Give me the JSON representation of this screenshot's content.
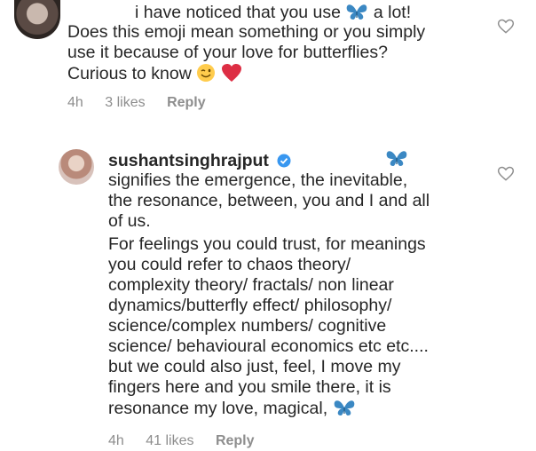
{
  "comment1": {
    "lines": [
      "i have noticed that you use",
      "a lot!",
      "Does this emoji mean something or you simply",
      "use it because of your love for butterflies?",
      "Curious to know"
    ],
    "meta": {
      "time": "4h",
      "likes": "3 likes",
      "reply": "Reply"
    }
  },
  "comment2": {
    "username": "sushantsinghrajput",
    "lines": [
      "signifies the emergence, the inevitable,",
      "the resonance, between, you and I and all",
      "of us.",
      "For feelings you could trust, for meanings",
      "you could refer to chaos theory/",
      "complexity theory/ fractals/ non linear",
      "dynamics/butterfly effect/ philosophy/",
      "science/complex numbers/ cognitive",
      "science/ behavioural economics etc etc....",
      "but we could also just, feel, I move my",
      "fingers here and you smile there, it is",
      "resonance my love, magical,"
    ],
    "meta": {
      "time": "4h",
      "likes": "41 likes",
      "reply": "Reply"
    }
  },
  "icons": {
    "butterfly": "butterfly-emoji",
    "wink": "winking-face-emoji",
    "heart": "red-heart-emoji",
    "like": "heart-outline-icon",
    "verified": "verified-badge-icon"
  },
  "colors": {
    "text": "#262626",
    "meta": "#8e8e8e",
    "butterfly": "#3b88c3",
    "heart": "#dd2e44",
    "verified": "#3897f0"
  }
}
